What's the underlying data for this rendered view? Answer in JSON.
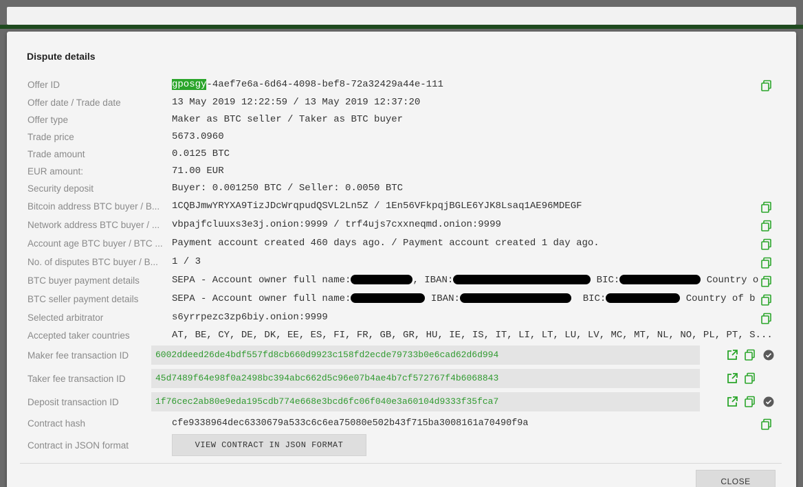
{
  "dialog": {
    "title": "Dispute details",
    "close_label": "CLOSE",
    "json_button_label": "VIEW CONTRACT IN JSON FORMAT"
  },
  "rows": [
    {
      "label": "Offer ID",
      "value_highlight": "gposgy",
      "value_rest": "-4aef7e6a-6d64-4098-bef8-72a32429a44e-111",
      "copy": true
    },
    {
      "label": "Offer date / Trade date",
      "value": "13 May 2019 12:22:59 / 13 May 2019 12:37:20"
    },
    {
      "label": "Offer type",
      "value": "Maker as BTC seller / Taker as BTC buyer"
    },
    {
      "label": "Trade price",
      "value": "5673.0960"
    },
    {
      "label": "Trade amount",
      "value": "0.0125 BTC"
    },
    {
      "label": "EUR amount:",
      "value": "71.00 EUR"
    },
    {
      "label": "Security deposit",
      "value": "Buyer: 0.001250 BTC / Seller: 0.0050 BTC"
    },
    {
      "label": "Bitcoin address BTC buyer / B...",
      "value": "1CQBJmwYRYXA9TizJDcWrqpudQSVL2Ln5Z / 1En56VFkpqjBGLE6YJK8Lsaq1AE96MDEGF",
      "copy": true
    },
    {
      "label": "Network address BTC buyer / ...",
      "value": "vbpajfcluuxs3e3j.onion:9999 / trf4ujs7cxxneqmd.onion:9999",
      "copy": true
    },
    {
      "label": "Account age BTC buyer / BTC ...",
      "value": "Payment account created 460 days ago. / Payment account created 1 day ago.",
      "copy": true
    },
    {
      "label": "No. of disputes BTC buyer / B...",
      "value": "1 / 3",
      "copy": true
    },
    {
      "label": "BTC buyer payment details",
      "p1": "SEPA - Account owner full name:",
      "p2": ", IBAN:",
      "p3": "BIC:",
      "p4": "Country o",
      "copy": true
    },
    {
      "label": "BTC seller payment details",
      "p1": "SEPA - Account owner full name:",
      "p2": "IBAN:",
      "p3": "BIC:",
      "p4": "Country of b",
      "copy": true
    },
    {
      "label": "Selected arbitrator",
      "value": "s6yrrpezc3zp6biy.onion:9999",
      "copy": true
    },
    {
      "label": "Accepted taker countries",
      "value": "AT, BE, CY, DE, DK, EE, ES, FI, FR, GB, GR, HU, IE, IS, IT, LI, LT, LU, LV, MC, MT, NL, NO, PL, PT, S..."
    }
  ],
  "tx_rows": [
    {
      "label": "Maker fee transaction ID",
      "value": "6002ddeed26de4bdf557fd8cb660d9923c158fd2ecde79733b0e6cad62d6d994",
      "confirmed": true
    },
    {
      "label": "Taker fee transaction ID",
      "value": "45d7489f64e98f0a2498bc394abc662d5c96e07b4ae4b7cf572767f4b6068843",
      "confirmed": false
    },
    {
      "label": "Deposit transaction ID",
      "value": "1f76cec2ab80e9eda195cdb774e668e3bcd6fc06f040e3a60104d9333f35fca7",
      "confirmed": true
    }
  ],
  "contract": {
    "hash_label": "Contract hash",
    "hash_value": "cfe9338964dec6330679a533c6c6ea75080e502b43f715ba3008161a70490f9a",
    "json_label": "Contract in JSON format"
  },
  "icons": {
    "copy": "copy-icon",
    "external_link": "external-link-icon",
    "check": "check-circle-icon"
  },
  "colors": {
    "accent": "#2aa52a",
    "tx_text": "#2f9a2f"
  }
}
